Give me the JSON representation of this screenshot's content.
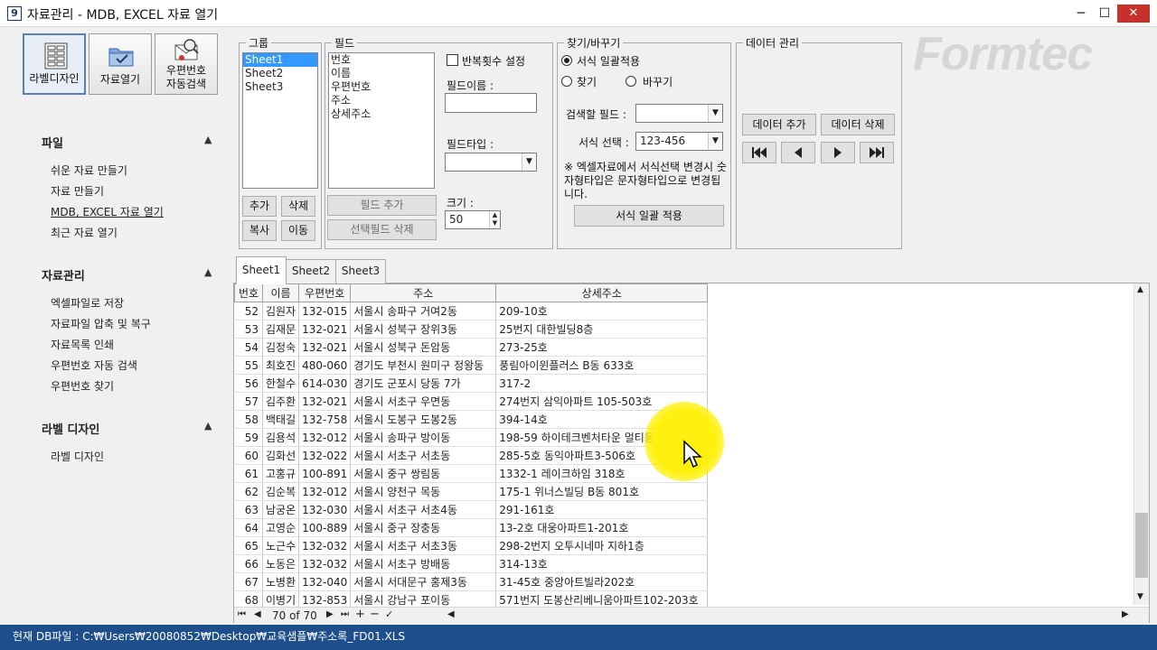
{
  "window": {
    "app_icon": "9",
    "title": "자료관리 - MDB, EXCEL 자료 열기",
    "minimize": "─",
    "maximize": "☐",
    "close": "✕"
  },
  "toolbar": {
    "label_design": "라벨디자인",
    "open_data": "자료열기",
    "zipcode_line1": "우편번호",
    "zipcode_line2": "자동검색"
  },
  "nav": {
    "sections": [
      {
        "title": "파일",
        "items": [
          "쉬운 자료 만들기",
          "자료 만들기",
          "MDB, EXCEL 자료 열기",
          "최근 자료 열기"
        ]
      },
      {
        "title": "자료관리",
        "items": [
          "엑셀파일로 저장",
          "자료파일 압축 및 복구",
          "자료목록 인쇄",
          "우편번호 자동 검색",
          "우편번호 찾기"
        ]
      },
      {
        "title": "라벨 디자인",
        "items": [
          "라벨 디자인"
        ]
      }
    ]
  },
  "group_panel": {
    "title": "그룹",
    "items": [
      "Sheet1",
      "Sheet2",
      "Sheet3"
    ],
    "selected": "Sheet1",
    "add": "추가",
    "delete": "삭제",
    "copy": "복사",
    "move": "이동"
  },
  "field_panel": {
    "title": "필드",
    "items": [
      "번호",
      "이름",
      "우편번호",
      "주소",
      "상세주소"
    ],
    "repeat_label": "반복횟수 설정",
    "field_name_label": "필드이름 :",
    "field_type_label": "필드타입 :",
    "size_label": "크기 :",
    "size_value": "50",
    "add_field": "필드 추가",
    "delete_field": "선택필드 삭제"
  },
  "find_panel": {
    "title": "찾기/바꾸기",
    "apply_format": "서식 일괄적용",
    "find": "찾기",
    "replace": "바꾸기",
    "search_field_label": "검색할 필드 :",
    "format_select_label": "서식 선택 :",
    "format_value": "123-456",
    "note": "※ 엑셀자료에서 서식선택 변경시 숫자형타입은 문자형타입으로 변경됩니다.",
    "apply_button": "서식 일괄 적용"
  },
  "data_panel": {
    "title": "데이터 관리",
    "add": "데이터 추가",
    "delete": "데이터 삭제"
  },
  "logo": "Formtec",
  "tabs": [
    "Sheet1",
    "Sheet2",
    "Sheet3"
  ],
  "active_tab": "Sheet1",
  "table": {
    "columns": [
      "번호",
      "이름",
      "우편번호",
      "주소",
      "상세주소"
    ],
    "rows": [
      [
        "52",
        "김원자",
        "132-015",
        "서울시 송파구 거여2동",
        "209-10호"
      ],
      [
        "53",
        "김재문",
        "132-021",
        "서울시 성북구 장위3동",
        "25번지 대한빌딩8층"
      ],
      [
        "54",
        "김정숙",
        "132-021",
        "서울시 성북구 돈암동",
        "273-25호"
      ],
      [
        "55",
        "최호진",
        "480-060",
        "경기도 부천시 원미구 정왕동",
        " 풍림아이윈플러스 B동 633호"
      ],
      [
        "56",
        "한철수",
        "614-030",
        "경기도 군포시 당동 7가",
        "317-2"
      ],
      [
        "57",
        "김주환",
        "132-021",
        "서울시 서초구 우면동",
        "274번지 삼익아파트 105-503호"
      ],
      [
        "58",
        "백태길",
        "132-758",
        "서울시 도봉구 도봉2동",
        "394-14호"
      ],
      [
        "59",
        "김용석",
        "132-012",
        "서울시 송파구 방이동",
        "198-59 하이테크벤처타운 멀티동"
      ],
      [
        "60",
        "김화선",
        "132-022",
        "서울시 서초구 서초동",
        "285-5호 동익아파트3-506호"
      ],
      [
        "61",
        "고홍규",
        "100-891",
        "서울시 중구 쌍림동",
        "1332-1 레이크하임 318호"
      ],
      [
        "62",
        "김순복",
        "132-012",
        "서울시 양천구 목동",
        "175-1 위너스빌딩 B동 801호"
      ],
      [
        "63",
        "남궁온",
        "132-030",
        "서울시 서초구 서초4동",
        "291-161호"
      ],
      [
        "64",
        "고영순",
        "100-889",
        "서울시 중구 장충동",
        "13-2호 대웅아파트1-201호"
      ],
      [
        "65",
        "노근수",
        "132-032",
        "서울시 서초구 서초3동",
        "298-2번지 오투시네마 지하1층"
      ],
      [
        "66",
        "노동은",
        "132-032",
        "서울시 서초구 방배동",
        "314-13호"
      ],
      [
        "67",
        "노병환",
        "132-040",
        "서울시 서대문구 홍제3동",
        "31-45호 중앙아트빌라202호"
      ],
      [
        "68",
        "이병기",
        "132-853",
        "서울시 강남구 포이동",
        "571번지 도봉산리베니움아파트102-203호"
      ]
    ]
  },
  "navigator": {
    "position": "70 of 70"
  },
  "status": {
    "text": "현재 DB파일 : C:₩Users₩20080852₩Desktop₩교육샘플₩주소록_FD01.XLS"
  },
  "colors": {
    "statusbar": "#1e4f8c",
    "selection": "#3399ff",
    "close": "#c7302b",
    "cursor_highlight": "#fff000"
  }
}
